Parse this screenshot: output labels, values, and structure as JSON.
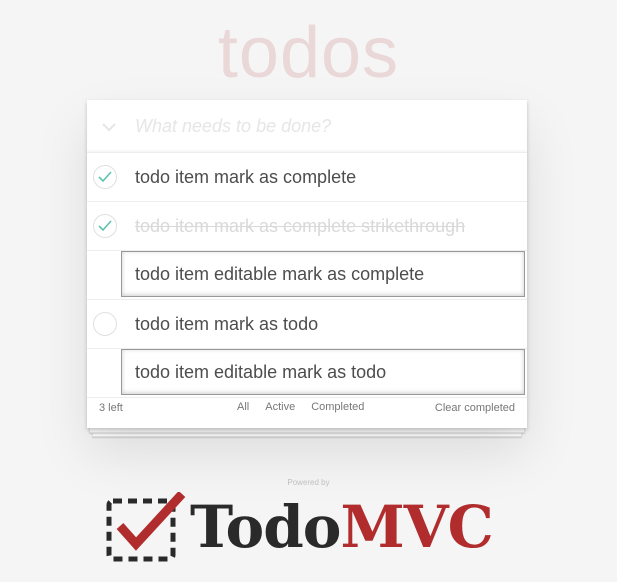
{
  "header": {
    "title": "todos",
    "new_todo_placeholder": "What needs to be done?"
  },
  "todos": [
    {
      "label": "todo item mark as complete",
      "completed": true,
      "editing": false
    },
    {
      "label": "todo item mark as complete strikethrough",
      "completed": true,
      "editing": false
    },
    {
      "label": "todo item editable mark as complete",
      "completed": false,
      "editing": true
    },
    {
      "label": "todo item mark as todo",
      "completed": false,
      "editing": false
    },
    {
      "label": "todo item editable mark as todo",
      "completed": false,
      "editing": true
    }
  ],
  "footer": {
    "count": "3 left",
    "filters": [
      "All",
      "Active",
      "Completed"
    ],
    "clear_label": "Clear completed"
  },
  "branding": {
    "powered_by": "Powered by",
    "logo_todo": "Todo",
    "logo_mvc": "MVC"
  },
  "colors": {
    "check_green": "#5dc2af",
    "brand_red": "#b12d2d"
  }
}
